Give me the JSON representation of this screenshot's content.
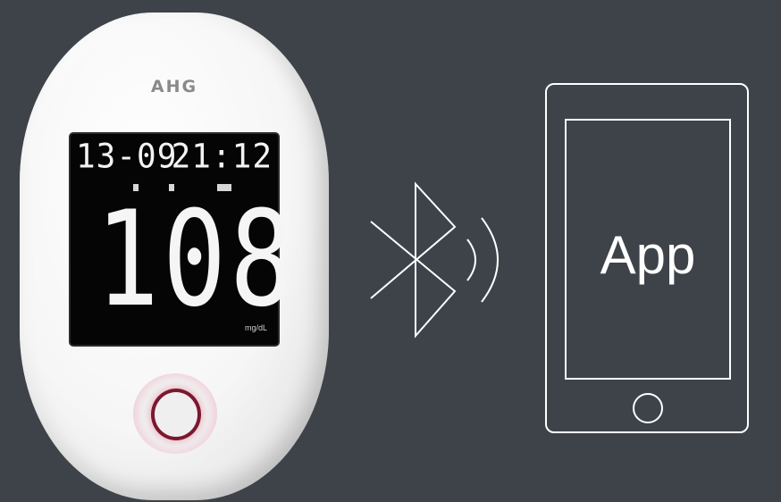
{
  "meter": {
    "brand": "AHG",
    "date": "13-09",
    "time": "21:12",
    "reading": "108",
    "unit": "mg/dL"
  },
  "tablet": {
    "label": "App"
  },
  "colors": {
    "background": "#3e4349",
    "line": "#ffffff",
    "button_ring": "#7c1830"
  },
  "icons": [
    "bluetooth-icon",
    "signal-waves-icon",
    "power-button-icon",
    "home-button-icon"
  ]
}
